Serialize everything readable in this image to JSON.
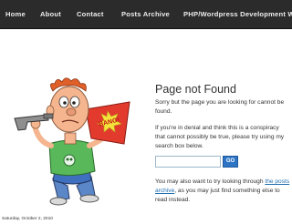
{
  "nav": {
    "items": [
      {
        "label": "Home"
      },
      {
        "label": "About"
      },
      {
        "label": "Contact"
      },
      {
        "label": "Posts Archive"
      },
      {
        "label": "PHP/Wordpress Development Work"
      }
    ]
  },
  "illustration": {
    "flag_text": "BANG!"
  },
  "content": {
    "title": "Page not Found",
    "para1": "Sorry but the page you are looking for cannot be found.",
    "para2": "If you're in denial and think this is a conspiracy that cannot possibly be true, please try using my search box below.",
    "para3_before": "You may also want to try looking through ",
    "para3_link": "the posts archive",
    "para3_after": ", as you may just find something else to read instead."
  },
  "search": {
    "value": "",
    "placeholder": "",
    "button_label": "GO"
  },
  "footer": {
    "date": "Saturday, October 2, 2010"
  },
  "colors": {
    "nav_background": "#2b2b2b",
    "link": "#1f6fb2",
    "button": "#2d74c4"
  }
}
